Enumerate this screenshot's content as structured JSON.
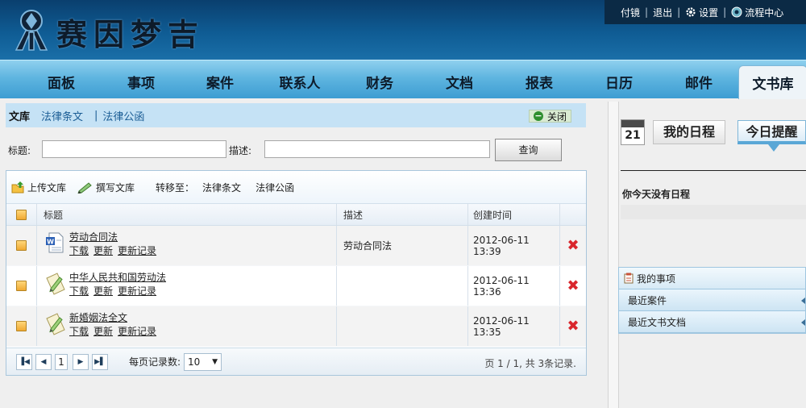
{
  "header": {
    "logo_text": "赛因梦吉",
    "user": "付镜",
    "logout": "退出",
    "settings": "设置",
    "workflow": "流程中心"
  },
  "nav": {
    "items": [
      "面板",
      "事项",
      "案件",
      "联系人",
      "财务",
      "文档",
      "报表",
      "日历",
      "邮件",
      "文书库"
    ],
    "active": "文书库"
  },
  "tabs": {
    "items": [
      "文库",
      "法律条文",
      "法律公函"
    ],
    "active": "文库",
    "close_label": "关闭"
  },
  "search": {
    "title_label": "标题:",
    "title_value": "",
    "desc_label": "描述:",
    "desc_value": "",
    "query_label": "查询"
  },
  "toolbar": {
    "upload_label": "上传文库",
    "compose_label": "撰写文库",
    "move_to_label": "转移至：",
    "move_targets": [
      "法律条文",
      "法律公函"
    ]
  },
  "table": {
    "columns": [
      "标题",
      "描述",
      "创建时间"
    ],
    "action_labels": [
      "下载",
      "更新",
      "更新记录"
    ],
    "rows": [
      {
        "title": "劳动合同法",
        "desc": "劳动合同法",
        "created": "2012-06-11 13:39",
        "icon": "word-doc-icon"
      },
      {
        "title": "中华人民共和国劳动法",
        "desc": "",
        "created": "2012-06-11 13:36",
        "icon": "pencil-note-icon"
      },
      {
        "title": "新婚姻法全文",
        "desc": "",
        "created": "2012-06-11 13:35",
        "icon": "pencil-note-icon"
      }
    ]
  },
  "pager": {
    "page": "1",
    "page_size_label": "每页记录数:",
    "page_size": "10",
    "info": "页 1 / 1, 共 3条记录."
  },
  "right": {
    "calendar_day": "21",
    "tab_schedule": "我的日程",
    "tab_reminder": "今日提醒",
    "no_schedule": "你今天没有日程",
    "menu": [
      "我的事项",
      "最近案件",
      "最近文书文档"
    ]
  },
  "colors": {
    "header_bg": "#0f5c94",
    "nav_bg": "#5fb5e0",
    "tab_bar_bg": "#c5e2f5",
    "delete_red": "#d9262c",
    "checkbox_orange": "#f0a932"
  }
}
